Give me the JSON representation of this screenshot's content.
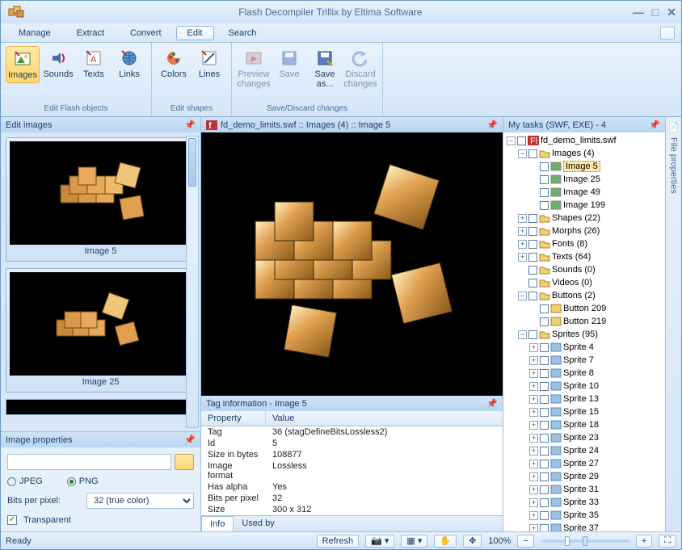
{
  "title": "Flash Decompiler Trillix by Eltima Software",
  "menu": {
    "manage": "Manage",
    "extract": "Extract",
    "convert": "Convert",
    "edit": "Edit",
    "search": "Search"
  },
  "ribbon": {
    "images": "Images",
    "sounds": "Sounds",
    "texts": "Texts",
    "links": "Links",
    "colors": "Colors",
    "lines": "Lines",
    "preview": "Preview\nchanges",
    "saveas": "Save\nas...",
    "discard": "Discard\nchanges",
    "group1": "Edit Flash objects",
    "group2": "Edit shapes",
    "group3": "Save/Discard changes"
  },
  "edit_images": {
    "title": "Edit images",
    "thumb1": "Image 5",
    "thumb2": "Image 25"
  },
  "img_props": {
    "title": "Image properties",
    "jpeg": "JPEG",
    "png": "PNG",
    "bpp_label": "Bits per pixel:",
    "bpp_value": "32 (true color)",
    "transparent": "Transparent"
  },
  "preview": {
    "title": "fd_demo_limits.swf :: Images (4) :: Image 5"
  },
  "taginfo": {
    "title": "Tag information - Image 5",
    "head_prop": "Property",
    "head_val": "Value",
    "rows": [
      {
        "p": "Tag",
        "v": "36 (stagDefineBitsLossless2)"
      },
      {
        "p": "Id",
        "v": "5"
      },
      {
        "p": "Size in bytes",
        "v": "108877"
      },
      {
        "p": "Image format",
        "v": "Lossless"
      },
      {
        "p": "Has alpha",
        "v": "Yes"
      },
      {
        "p": "Bits per pixel",
        "v": "32"
      },
      {
        "p": "Size",
        "v": "300 x 312"
      }
    ],
    "tab_info": "Info",
    "tab_usedby": "Used by"
  },
  "mytasks": {
    "title": "My tasks (SWF, EXE) - 4"
  },
  "tree": {
    "root": "fd_demo_limits.swf",
    "images": "Images (4)",
    "img5": "Image 5",
    "img25": "Image 25",
    "img49": "Image 49",
    "img199": "Image 199",
    "shapes": "Shapes (22)",
    "morphs": "Morphs (26)",
    "fonts": "Fonts (8)",
    "texts": "Texts (64)",
    "sounds": "Sounds (0)",
    "videos": "Videos (0)",
    "buttons": "Buttons (2)",
    "btn209": "Button 209",
    "btn219": "Button 219",
    "sprites": "Sprites (95)",
    "sp": [
      "Sprite 4",
      "Sprite 7",
      "Sprite 8",
      "Sprite 10",
      "Sprite 13",
      "Sprite 15",
      "Sprite 18",
      "Sprite 23",
      "Sprite 24",
      "Sprite 27",
      "Sprite 29",
      "Sprite 31",
      "Sprite 33",
      "Sprite 35",
      "Sprite 37"
    ]
  },
  "side_tab": "File properties",
  "status": {
    "ready": "Ready",
    "refresh": "Refresh",
    "zoom": "100%"
  }
}
